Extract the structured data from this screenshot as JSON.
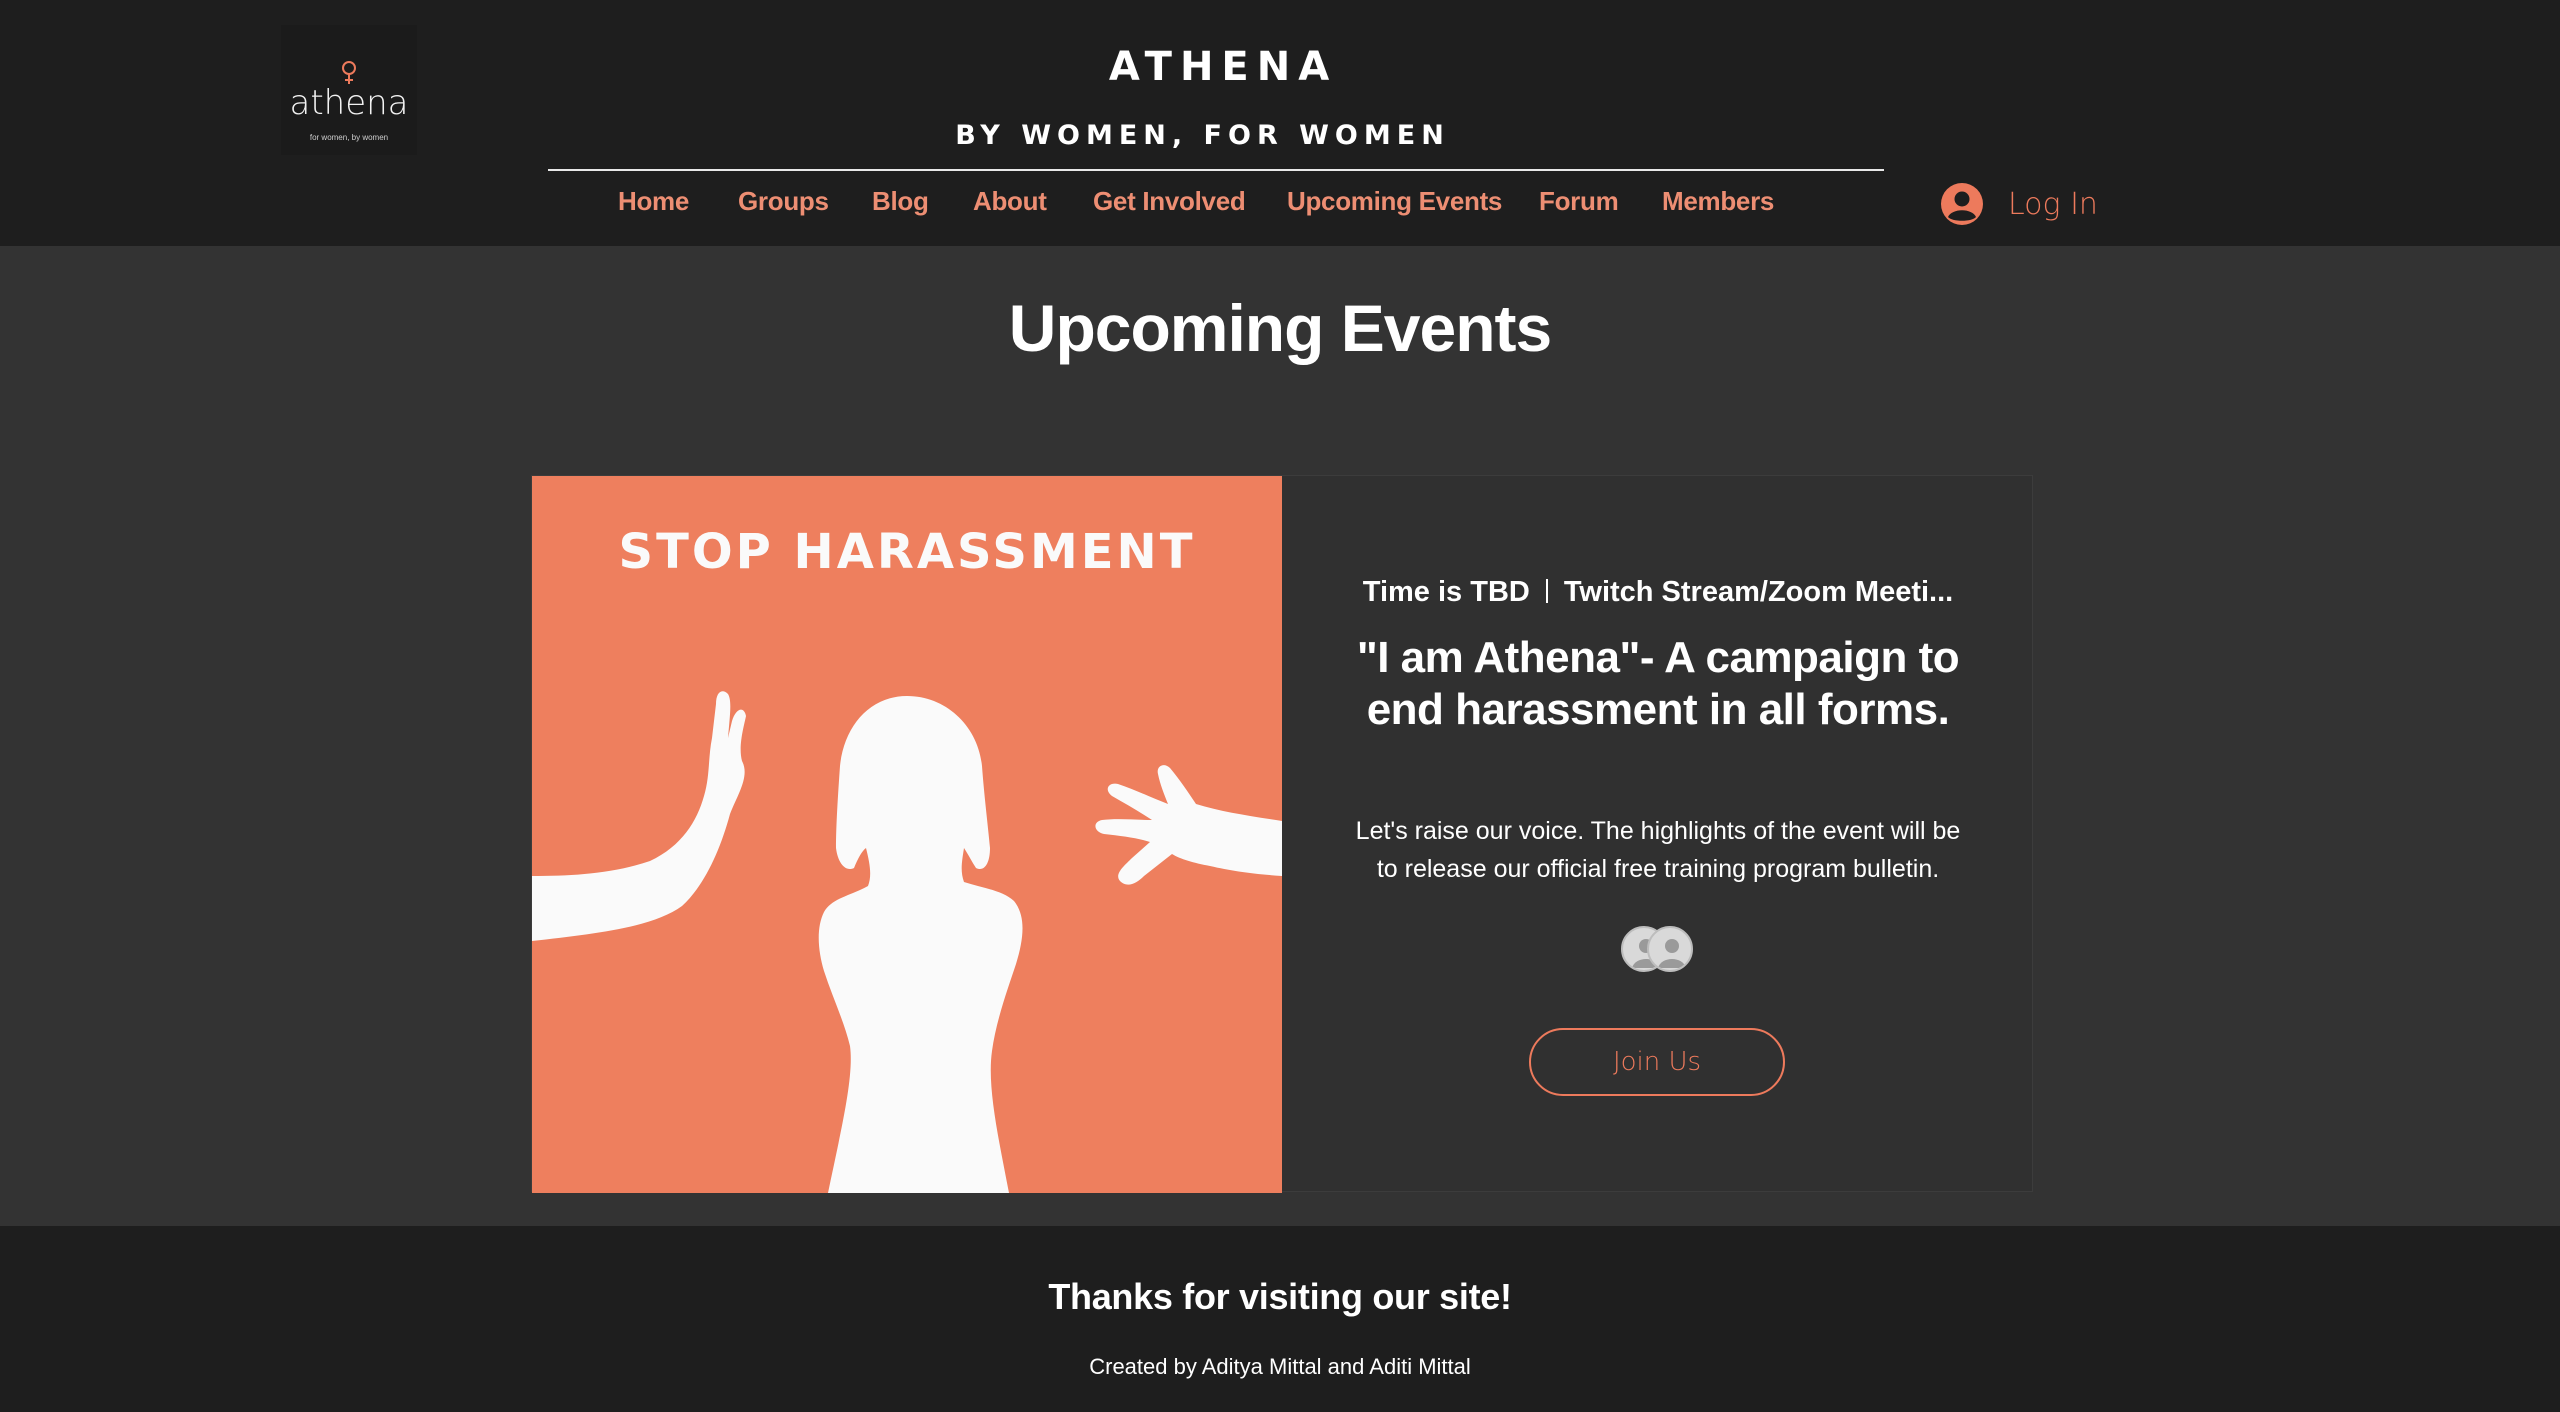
{
  "header": {
    "logo": {
      "wordmark": "athena",
      "tagline": "for women, by women"
    },
    "title": "ATHENA",
    "tagline": "BY WOMEN, FOR WOMEN",
    "nav": [
      {
        "label": "Home",
        "icon": null
      },
      {
        "label": "Groups",
        "icon": null
      },
      {
        "label": "Blog",
        "icon": null
      },
      {
        "label": "About",
        "icon": null
      },
      {
        "label": "Get Involved",
        "icon": null
      },
      {
        "label": "Upcoming Events",
        "icon": null
      },
      {
        "label": "Forum",
        "icon": null
      },
      {
        "label": "Members",
        "icon": null
      }
    ],
    "login": {
      "label": "Log In",
      "icon": "user-avatar-icon"
    }
  },
  "main": {
    "heading": "Upcoming Events",
    "event": {
      "image_text": "STOP HARASSMENT",
      "time": "Time is TBD",
      "location": "Twitch Stream/Zoom Meeti...",
      "title": "\"I am Athena\"- A campaign to end harassment in all forms.",
      "description": "Let's raise our voice. The highlights of the event will be to release our official free training program bulletin.",
      "attendees_icon": "attendee-avatar-icon",
      "join_label": "Join Us"
    }
  },
  "footer": {
    "heading": "Thanks for visiting our site!",
    "credit": "Created by Aditya Mittal and Aditi Mittal"
  },
  "colors": {
    "header_bg": "#1e1e1e",
    "page_bg": "#333333",
    "accent": "#ed7a5c",
    "nav_text": "#ed8e73",
    "image_bg": "#ee7f5e",
    "text": "#ffffff"
  }
}
